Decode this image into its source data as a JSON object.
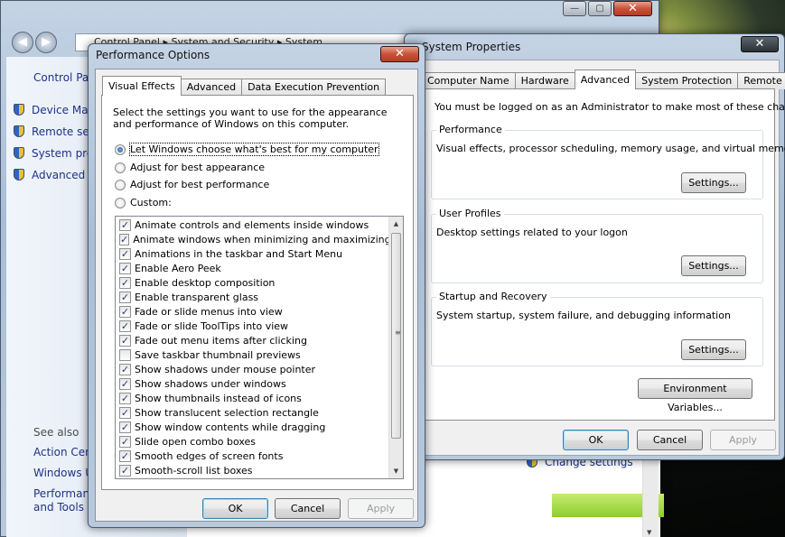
{
  "cp": {
    "breadcrumb": [
      "Control Panel",
      "System and Security",
      "System"
    ],
    "home": "Control Panel Home",
    "items": [
      "Device Manager",
      "Remote settings",
      "System protection",
      "Advanced system settings"
    ],
    "see_also": "See also",
    "see_items": [
      "Action Center",
      "Windows Update",
      "Performance Information and Tools"
    ],
    "change_settings": "Change settings"
  },
  "sp": {
    "title": "System Properties",
    "tabs": [
      "Computer Name",
      "Hardware",
      "Advanced",
      "System Protection",
      "Remote"
    ],
    "admin_note": "You must be logged on as an Administrator to make most of these changes.",
    "groups": [
      {
        "label": "Performance",
        "desc": "Visual effects, processor scheduling, memory usage, and virtual memory",
        "button": "Settings..."
      },
      {
        "label": "User Profiles",
        "desc": "Desktop settings related to your logon",
        "button": "Settings..."
      },
      {
        "label": "Startup and Recovery",
        "desc": "System startup, system failure, and debugging information",
        "button": "Settings..."
      }
    ],
    "env_button": "Environment Variables...",
    "ok": "OK",
    "cancel": "Cancel",
    "apply": "Apply"
  },
  "po": {
    "title": "Performance Options",
    "tabs": [
      "Visual Effects",
      "Advanced",
      "Data Execution Prevention"
    ],
    "intro": "Select the settings you want to use for the appearance and performance of Windows on this computer.",
    "radios": [
      "Let Windows choose what's best for my computer",
      "Adjust for best appearance",
      "Adjust for best performance",
      "Custom:"
    ],
    "selected_radio": 0,
    "effects": [
      {
        "label": "Animate controls and elements inside windows",
        "checked": true
      },
      {
        "label": "Animate windows when minimizing and maximizing",
        "checked": true
      },
      {
        "label": "Animations in the taskbar and Start Menu",
        "checked": true
      },
      {
        "label": "Enable Aero Peek",
        "checked": true
      },
      {
        "label": "Enable desktop composition",
        "checked": true
      },
      {
        "label": "Enable transparent glass",
        "checked": true
      },
      {
        "label": "Fade or slide menus into view",
        "checked": true
      },
      {
        "label": "Fade or slide ToolTips into view",
        "checked": true
      },
      {
        "label": "Fade out menu items after clicking",
        "checked": true
      },
      {
        "label": "Save taskbar thumbnail previews",
        "checked": false
      },
      {
        "label": "Show shadows under mouse pointer",
        "checked": true
      },
      {
        "label": "Show shadows under windows",
        "checked": true
      },
      {
        "label": "Show thumbnails instead of icons",
        "checked": true
      },
      {
        "label": "Show translucent selection rectangle",
        "checked": true
      },
      {
        "label": "Show window contents while dragging",
        "checked": true
      },
      {
        "label": "Slide open combo boxes",
        "checked": true
      },
      {
        "label": "Smooth edges of screen fonts",
        "checked": true
      },
      {
        "label": "Smooth-scroll list boxes",
        "checked": true
      }
    ],
    "ok": "OK",
    "cancel": "Cancel",
    "apply": "Apply"
  },
  "close_glyph": "✕"
}
